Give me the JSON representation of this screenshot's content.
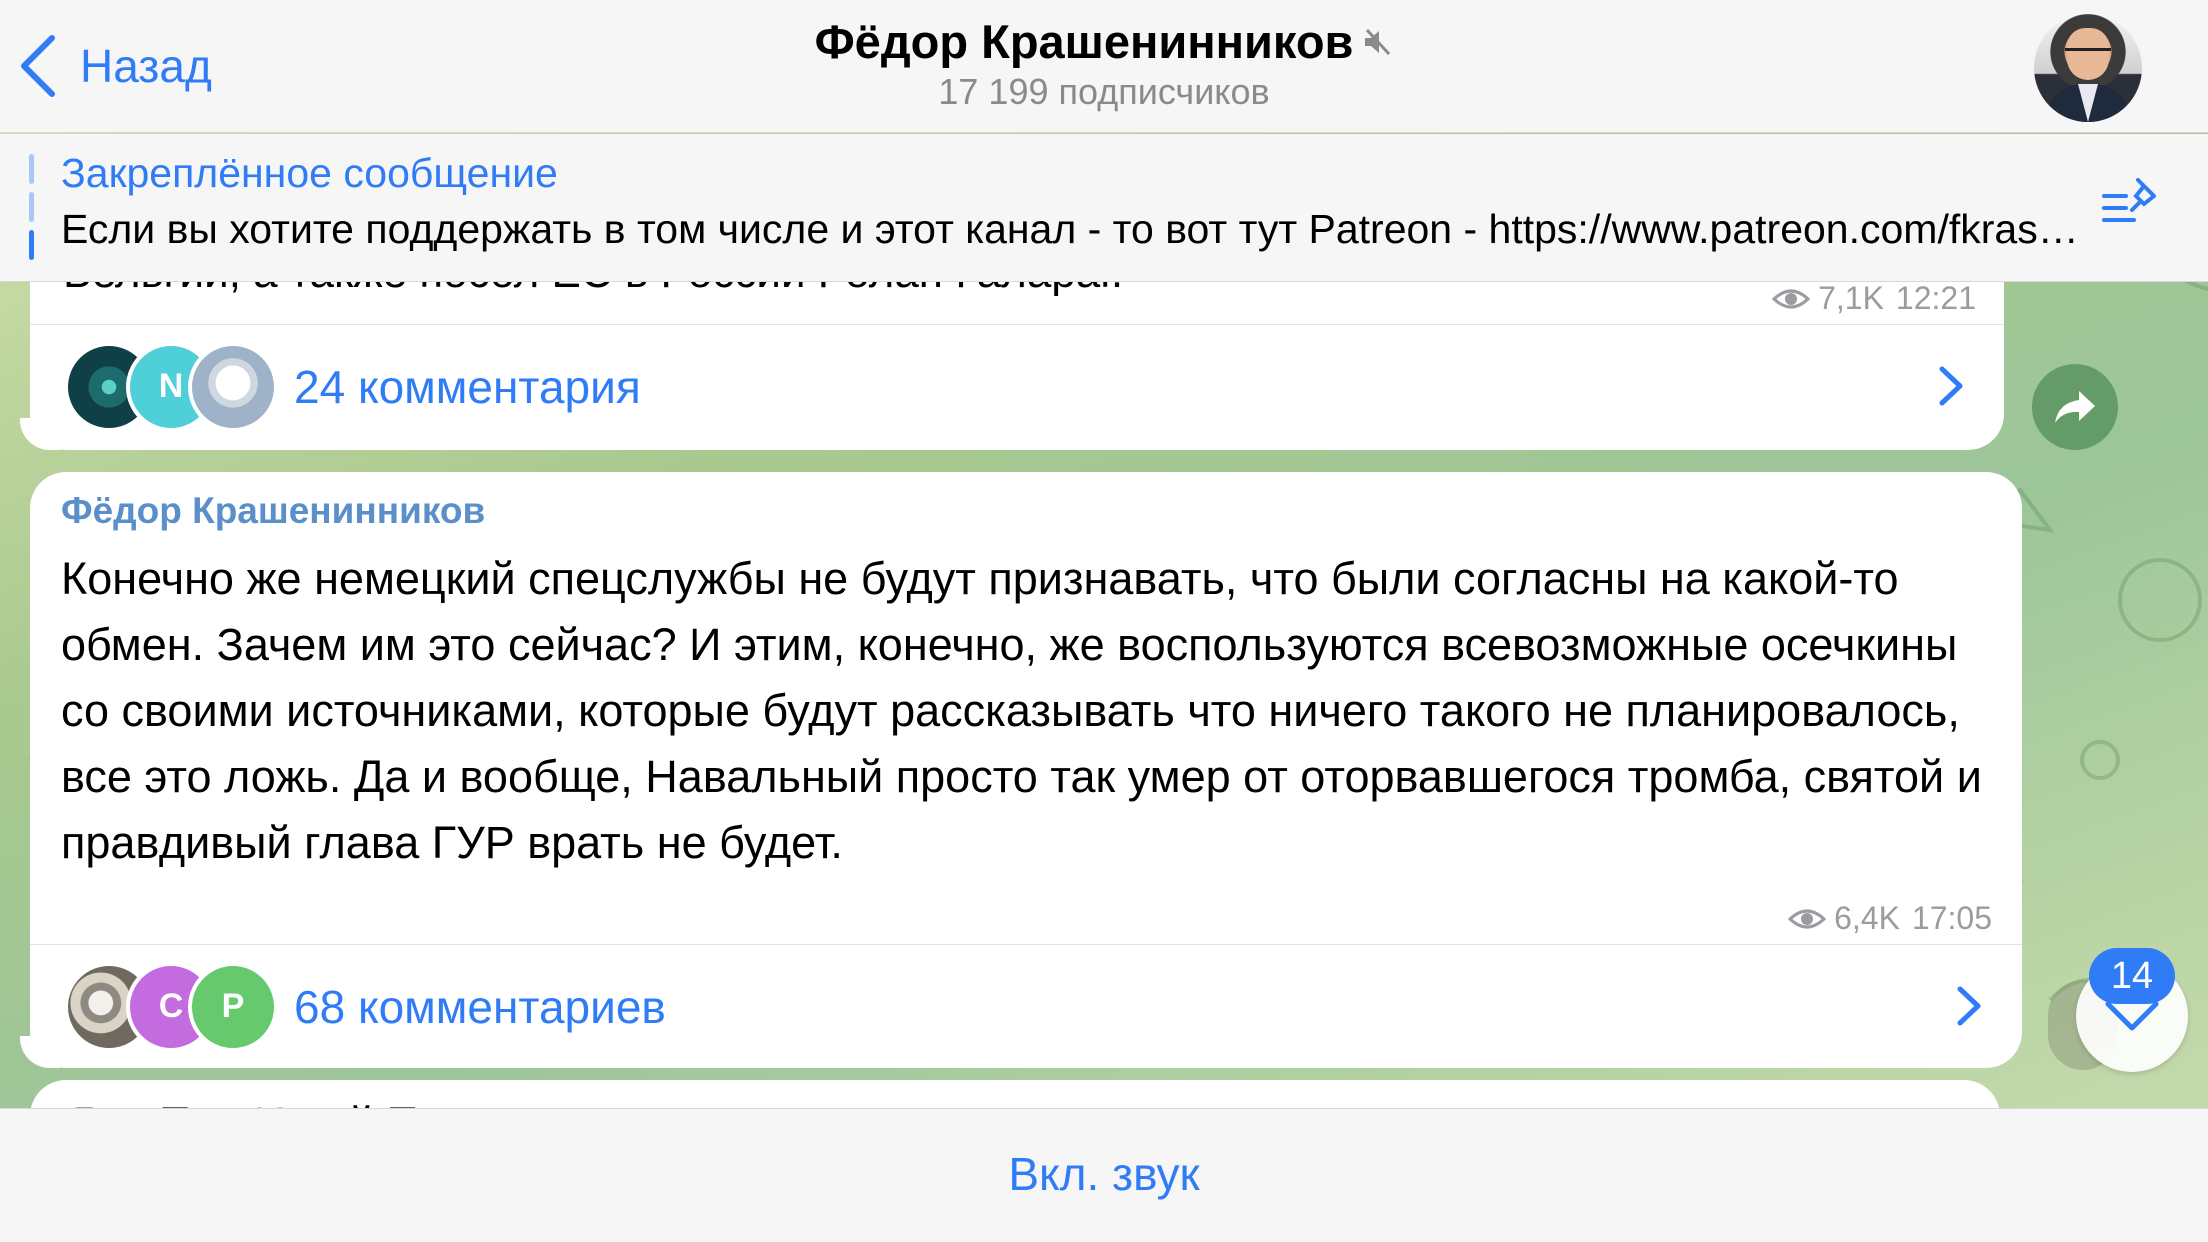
{
  "header": {
    "back_label": "Назад",
    "title": "Фёдор Крашенинников",
    "subtitle": "17 199 подписчиков"
  },
  "pinned": {
    "title": "Закреплённое сообщение",
    "text": "Если вы хотите поддержать в том числе и этот канал - то вот тут Patreon - https://www.patreon.com/fkrasheninnikov"
  },
  "messages": [
    {
      "text_partial": "Бельгии, а также посол ЕС в России Ролан Галараг.",
      "views": "7,1K",
      "time": "12:21",
      "comments_label": "24 комментария",
      "comment_avatars": [
        {
          "initial": "",
          "color": "#1c6c6e"
        },
        {
          "initial": "N",
          "color": "#4fd0d8"
        },
        {
          "initial": "",
          "color": "#9fb3c8"
        }
      ]
    },
    {
      "author": "Фёдор Крашенинников",
      "text": "Конечно же немецкий спецслужбы не будут признавать, что были согласны на какой-то обмен. Зачем им это сейчас? И этим, конечно, же воспользуются всевозможные осечкины со своими источниками, которые будут рассказывать что ничего такого не планировалось, все это ложь. Да и вообще, Навальный просто так умер от оторвавшегося тромба, святой и правдивый глава ГУР врать не будет.",
      "views": "6,4K",
      "time": "17:05",
      "comments_label": "68 комментариев",
      "comment_avatars": [
        {
          "initial": "",
          "color": "#8e8a82"
        },
        {
          "initial": "C",
          "color": "#c56be0"
        },
        {
          "initial": "P",
          "color": "#66c96e"
        }
      ]
    },
    {
      "text_partial": "Я ... П ... И ... й П"
    }
  ],
  "floating": {
    "unread_count": "14"
  },
  "bottom": {
    "unmute_label": "Вкл. звук"
  },
  "colors": {
    "accent": "#2f7cf6",
    "bar_bg": "#f6f6f6",
    "meta_grey": "#9b9ba0"
  }
}
